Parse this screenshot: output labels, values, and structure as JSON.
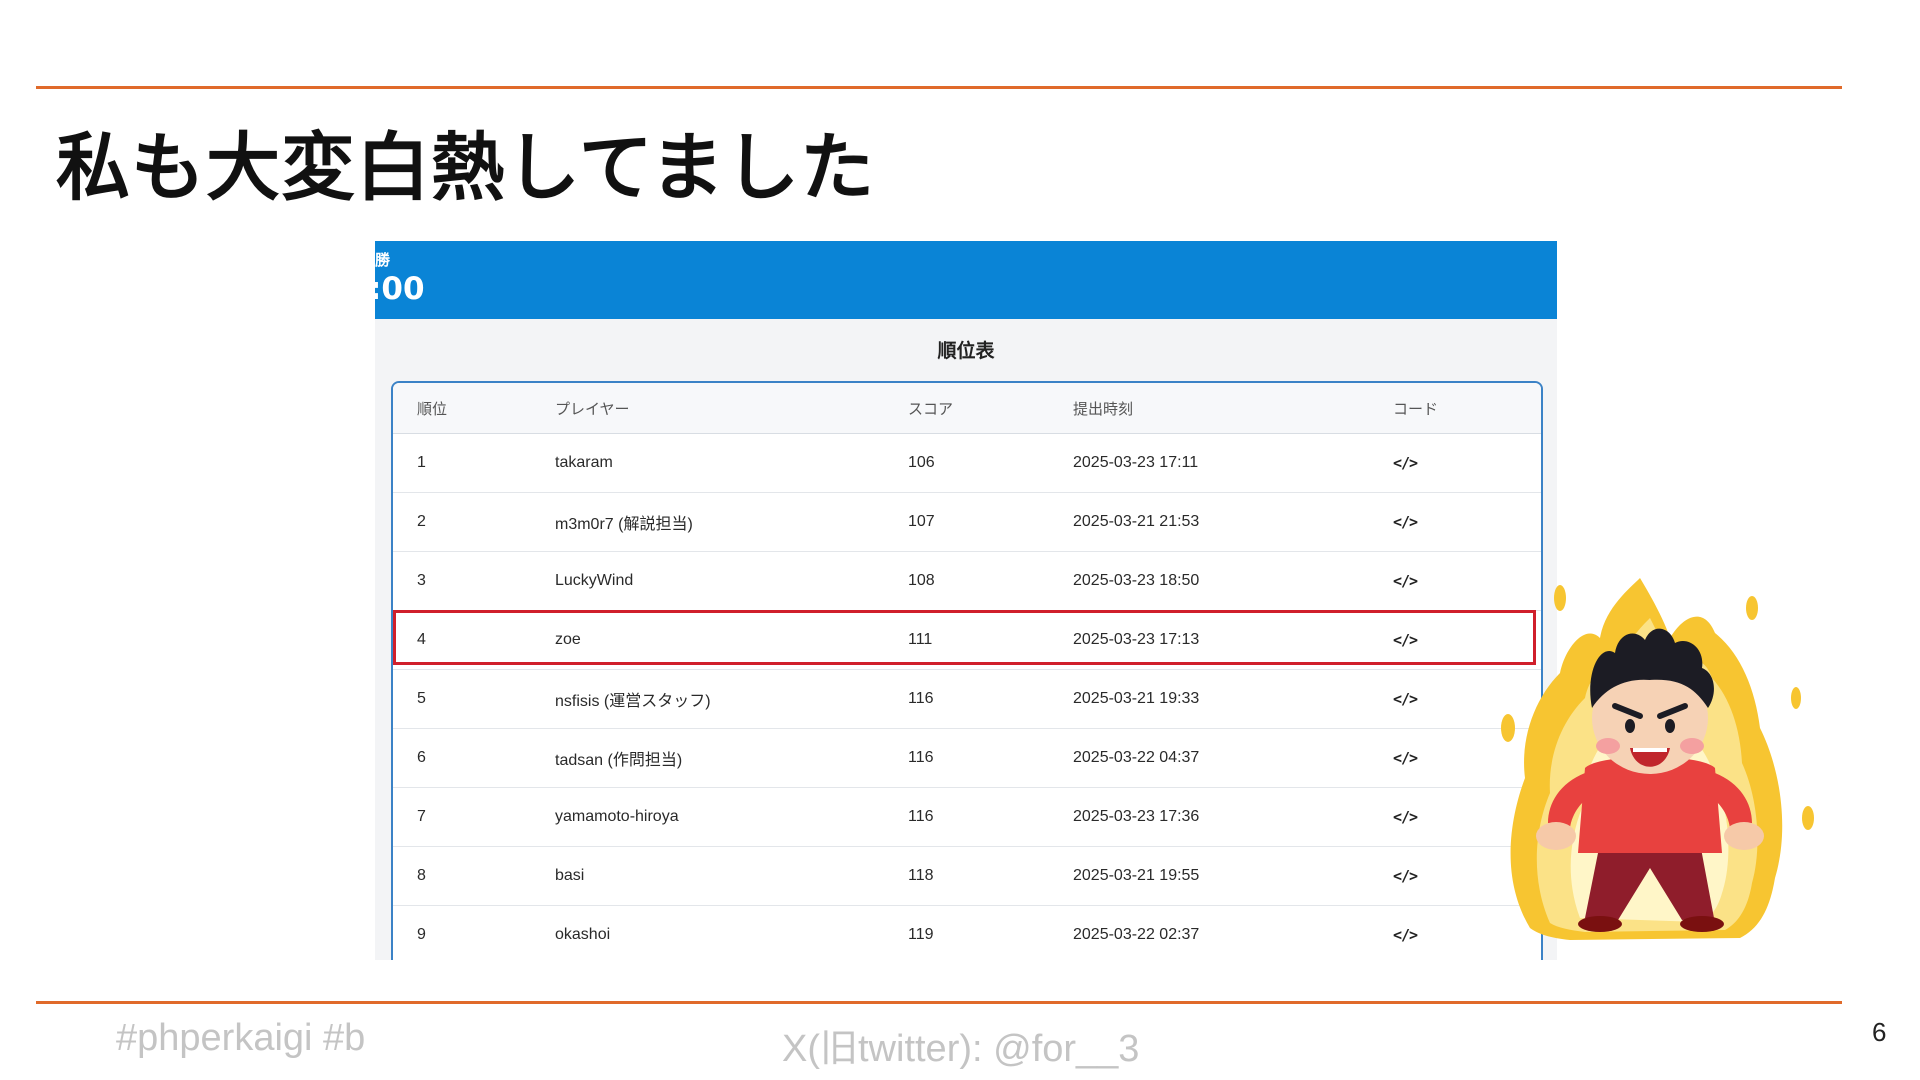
{
  "slide": {
    "title": "私も大変白熱してました",
    "page_number": "6",
    "footer_left": "#phperkaigi #b",
    "footer_center": "X(旧twitter): @for__3"
  },
  "screenshot": {
    "banner_small": "勝",
    "banner_big": ":00",
    "table_title": "順位表",
    "columns": {
      "rank": "順位",
      "player": "プレイヤー",
      "score": "スコア",
      "time": "提出時刻",
      "code": "コード"
    },
    "code_icon": "</>",
    "rows": [
      {
        "rank": "1",
        "player": "takaram",
        "score": "106",
        "time": "2025-03-23 17:11"
      },
      {
        "rank": "2",
        "player": "m3m0r7 (解説担当)",
        "score": "107",
        "time": "2025-03-21 21:53"
      },
      {
        "rank": "3",
        "player": "LuckyWind",
        "score": "108",
        "time": "2025-03-23 18:50"
      },
      {
        "rank": "4",
        "player": "zoe",
        "score": "111",
        "time": "2025-03-23 17:13"
      },
      {
        "rank": "5",
        "player": "nsfisis (運営スタッフ)",
        "score": "116",
        "time": "2025-03-21 19:33"
      },
      {
        "rank": "6",
        "player": "tadsan (作問担当)",
        "score": "116",
        "time": "2025-03-22 04:37"
      },
      {
        "rank": "7",
        "player": "yamamoto-hiroya",
        "score": "116",
        "time": "2025-03-23 17:36"
      },
      {
        "rank": "8",
        "player": "basi",
        "score": "118",
        "time": "2025-03-21 19:55"
      },
      {
        "rank": "9",
        "player": "okashoi",
        "score": "119",
        "time": "2025-03-22 02:37"
      }
    ],
    "highlighted_row": 4
  },
  "colors": {
    "accent_rule": "#e06a2a",
    "banner": "#0a84d6",
    "table_border": "#3b82c6",
    "highlight": "#d01f2b"
  },
  "illustration": {
    "icon": "fired-up-person-icon"
  }
}
